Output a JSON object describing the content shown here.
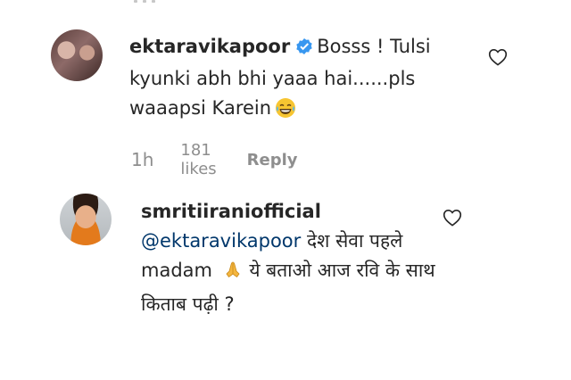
{
  "comments": [
    {
      "username": "ektaravikapoor",
      "verified": true,
      "text": "Bosss ! Tulsi kyunki abh bhi yaaa hai......pls waaapsi Karein",
      "emoji": "joy-emoji",
      "time": "1h",
      "likes": "181 likes",
      "reply_label": "Reply",
      "like_icon": "heart-outline-icon"
    },
    {
      "username": "smritiiraniofficial",
      "mention": "@ektaravikapoor",
      "text_before_emoji": "देश सेवा पहले madam",
      "emoji": "folded-hands-emoji",
      "text_after_emoji": "ये बताओ आज रवि के साथ किताब पढ़ी ?",
      "like_icon": "heart-outline-icon"
    }
  ],
  "colors": {
    "text": "#262626",
    "secondary": "#8e8e8e",
    "mention": "#00376b",
    "verified_badge": "#3897f0"
  }
}
